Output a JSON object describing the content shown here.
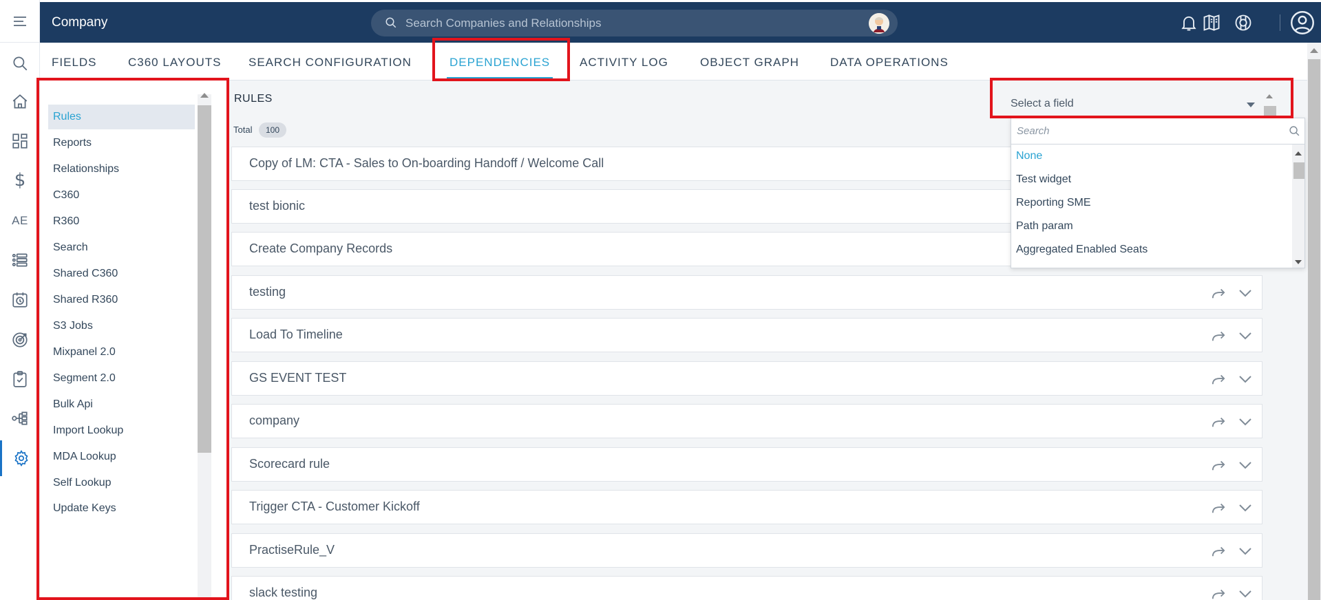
{
  "header": {
    "title": "Company",
    "search_placeholder": "Search Companies and Relationships"
  },
  "tabs": [
    {
      "label": "FIELDS"
    },
    {
      "label": "C360 LAYOUTS"
    },
    {
      "label": "SEARCH CONFIGURATION"
    },
    {
      "label": "DEPENDENCIES"
    },
    {
      "label": "ACTIVITY LOG"
    },
    {
      "label": "OBJECT GRAPH"
    },
    {
      "label": "DATA OPERATIONS"
    }
  ],
  "rail": {
    "ae_label": "AE",
    "dollar_label": "$"
  },
  "sidebar": {
    "items": [
      {
        "label": "Rules"
      },
      {
        "label": "Reports"
      },
      {
        "label": "Relationships"
      },
      {
        "label": "C360"
      },
      {
        "label": "R360"
      },
      {
        "label": "Search"
      },
      {
        "label": "Shared C360"
      },
      {
        "label": "Shared R360"
      },
      {
        "label": "S3 Jobs"
      },
      {
        "label": "Mixpanel 2.0"
      },
      {
        "label": "Segment 2.0"
      },
      {
        "label": "Bulk Api"
      },
      {
        "label": "Import Lookup"
      },
      {
        "label": "MDA Lookup"
      },
      {
        "label": "Self Lookup"
      },
      {
        "label": "Update Keys"
      }
    ]
  },
  "main": {
    "title": "RULES",
    "total_label": "Total",
    "total_count": "100",
    "rules": [
      {
        "name": "Copy of LM: CTA - Sales to On-boarding Handoff / Welcome Call"
      },
      {
        "name": "test bionic"
      },
      {
        "name": "Create Company Records"
      },
      {
        "name": "testing"
      },
      {
        "name": "Load To Timeline"
      },
      {
        "name": "GS EVENT TEST"
      },
      {
        "name": "company"
      },
      {
        "name": "Scorecard rule"
      },
      {
        "name": "Trigger CTA - Customer Kickoff"
      },
      {
        "name": "PractiseRule_V"
      },
      {
        "name": "slack testing"
      }
    ]
  },
  "field_select": {
    "label": "Select a field",
    "search_placeholder": "Search",
    "options": [
      {
        "label": "None"
      },
      {
        "label": "Test widget"
      },
      {
        "label": "Reporting SME"
      },
      {
        "label": "Path param"
      },
      {
        "label": "Aggregated Enabled Seats"
      }
    ]
  },
  "colors": {
    "header_bg": "#1c3b61",
    "accent": "#2aa3d2",
    "highlight": "#e2141c"
  }
}
